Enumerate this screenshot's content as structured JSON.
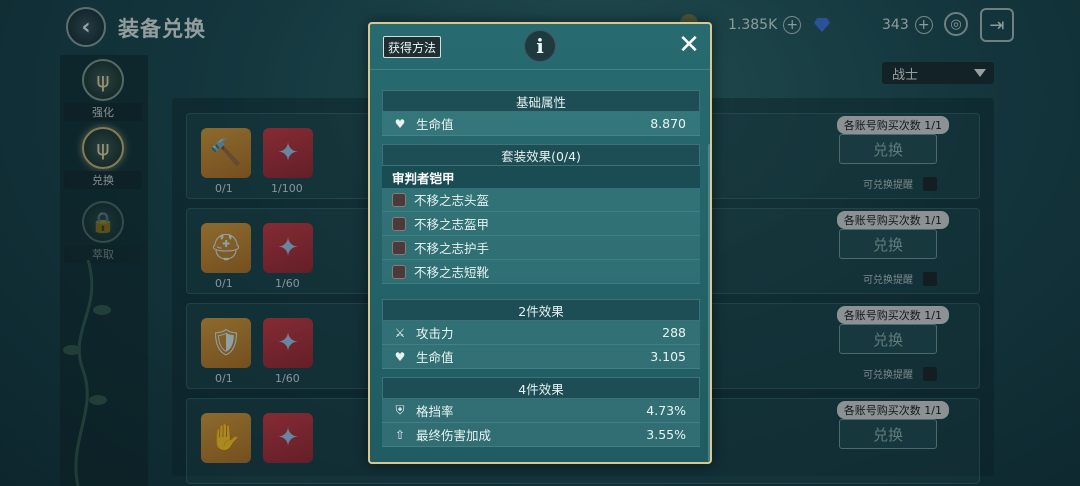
{
  "header": {
    "title": "装备兑换",
    "gold_amount": "1.385K",
    "gem_amount": "343"
  },
  "nav": {
    "items": [
      {
        "label": "强化"
      },
      {
        "label": "兑换"
      },
      {
        "label": "萃取"
      }
    ]
  },
  "role_select": {
    "value": "战士"
  },
  "rows": [
    {
      "buy_tag": "各账号购买次数 1/1",
      "exchange_label": "兑换",
      "remind_label": "可兑换提醒",
      "count_a": "0/1",
      "count_b": "1/100"
    },
    {
      "buy_tag": "各账号购买次数 1/1",
      "exchange_label": "兑换",
      "remind_label": "可兑换提醒",
      "count_a": "0/1",
      "count_b": "1/60"
    },
    {
      "buy_tag": "各账号购买次数 1/1",
      "exchange_label": "兑换",
      "remind_label": "可兑换提醒",
      "count_a": "0/1",
      "count_b": "1/60"
    },
    {
      "buy_tag": "各账号购买次数 1/1",
      "exchange_label": "兑换",
      "remind_label": "",
      "count_a": "",
      "count_b": ""
    }
  ],
  "modal": {
    "howto_label": "获得方法",
    "info_icon": "i",
    "close_icon": "✕",
    "base": {
      "title": "基础属性",
      "stats": [
        {
          "icon": "heart-icon",
          "name": "生命值",
          "value": "8.870"
        }
      ]
    },
    "set": {
      "title": "套装效果(0/4)",
      "name": "审判者铠甲",
      "pieces": [
        "不移之志头盔",
        "不移之志盔甲",
        "不移之志护手",
        "不移之志短靴"
      ]
    },
    "two_piece": {
      "title": "2件效果",
      "stats": [
        {
          "icon": "swords-icon",
          "name": "攻击力",
          "value": "288"
        },
        {
          "icon": "heart-icon",
          "name": "生命值",
          "value": "3.105"
        }
      ]
    },
    "four_piece": {
      "title": "4件效果",
      "stats": [
        {
          "icon": "block-icon",
          "name": "格挡率",
          "value": "4.73%"
        },
        {
          "icon": "damage-up-icon",
          "name": "最终伤害加成",
          "value": "3.55%"
        }
      ]
    }
  }
}
